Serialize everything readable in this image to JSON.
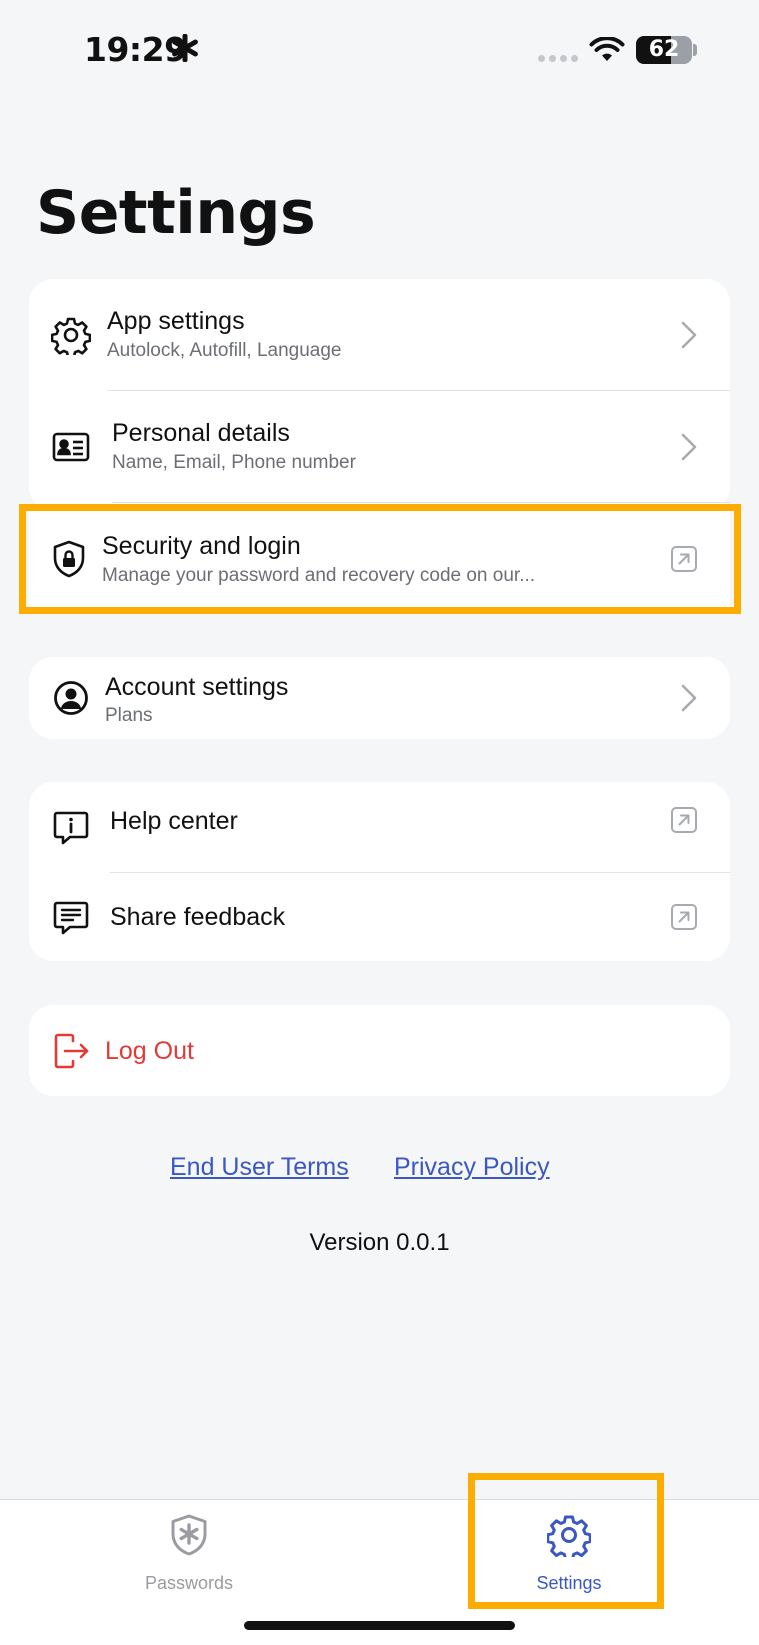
{
  "status": {
    "time": "19:29",
    "battery": "62",
    "battery_level": 0.62
  },
  "title": "Settings",
  "sections": {
    "general": [
      {
        "title": "App settings",
        "subtitle": "Autolock, Autofill, Language",
        "icon": "gear-icon",
        "action": "chevron"
      },
      {
        "title": "Personal details",
        "subtitle": "Name, Email, Phone number",
        "icon": "id-card-icon",
        "action": "chevron"
      },
      {
        "title": "Security and login",
        "subtitle": "Manage your password and recovery code on our...",
        "icon": "shield-lock-icon",
        "action": "external"
      }
    ],
    "account": [
      {
        "title": "Account settings",
        "subtitle": "Plans",
        "icon": "user-circle-icon",
        "action": "chevron"
      }
    ],
    "support": [
      {
        "title": "Help center",
        "icon": "help-bubble-icon",
        "action": "external"
      },
      {
        "title": "Share feedback",
        "icon": "feedback-bubble-icon",
        "action": "external"
      }
    ],
    "logout": {
      "label": "Log Out",
      "icon": "logout-icon",
      "color": "#e23b35"
    }
  },
  "footer": {
    "terms": "End User Terms",
    "privacy": "Privacy Policy",
    "version": "Version 0.0.1",
    "link_color": "#3a57c4"
  },
  "tabs": [
    {
      "label": "Passwords",
      "icon": "shield-asterisk-icon",
      "active": false
    },
    {
      "label": "Settings",
      "icon": "gear-icon",
      "active": true
    }
  ],
  "colors": {
    "accent": "#3a57c4",
    "highlight": "#fcad00",
    "background": "#f5f6f8"
  }
}
